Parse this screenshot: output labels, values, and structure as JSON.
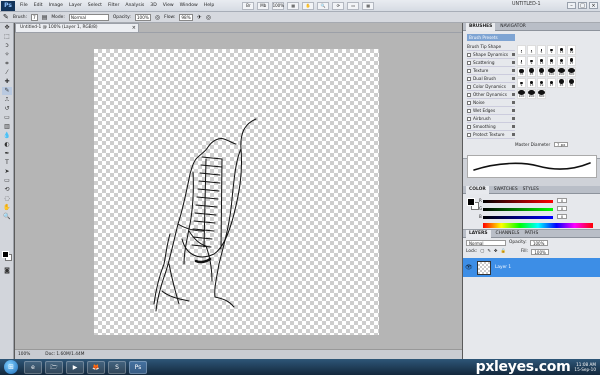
{
  "app": {
    "logo": "Ps"
  },
  "menu": [
    "File",
    "Edit",
    "Image",
    "Layer",
    "Select",
    "Filter",
    "Analysis",
    "3D",
    "View",
    "Window",
    "Help"
  ],
  "menu_icons": [
    "Br",
    "Mb",
    "100%",
    "▦",
    "✋",
    "🔍",
    "⟳",
    "▭",
    "▦"
  ],
  "workspace": "UNTITLED-1",
  "window_buttons": [
    "–",
    "□",
    "×"
  ],
  "options": {
    "brush_label": "Brush:",
    "brush_size": "7",
    "mode_label": "Mode:",
    "mode_value": "Normal",
    "opacity_label": "Opacity:",
    "opacity_value": "100%",
    "flow_label": "Flow:",
    "flow_value": "98%"
  },
  "document": {
    "tab_title": "Untitled-1 @ 100% (Layer 1, RGB/8)",
    "close": "×",
    "status_zoom": "100%",
    "status_doc": "Doc: 1.60M/1.44M"
  },
  "brushes_panel": {
    "tabs": [
      "BRUSHES",
      "NAVIGATOR"
    ],
    "preset_label": "Brush Presets",
    "items": [
      "Brush Tip Shape",
      "Shape Dynamics",
      "Scattering",
      "Texture",
      "Dual Brush",
      "Color Dynamics",
      "Other Dynamics",
      "Noise",
      "Wet Edges",
      "Airbrush",
      "Smoothing",
      "Protect Texture"
    ],
    "grid_numbers": [
      "1",
      "3",
      "5",
      "9",
      "13",
      "19",
      "5",
      "9",
      "13",
      "17",
      "21",
      "27",
      "35",
      "45",
      "65",
      "100",
      "200",
      "300",
      "9",
      "13",
      "19",
      "17",
      "45",
      "65",
      "100",
      "200",
      "300"
    ],
    "master_label": "Master Diameter",
    "master_value": "7 px"
  },
  "color_panel": {
    "tabs": [
      "COLOR",
      "SWATCHES",
      "STYLES"
    ],
    "labels": [
      "R",
      "G",
      "B"
    ],
    "values": [
      "0",
      "0",
      "0"
    ]
  },
  "layers_panel": {
    "tabs": [
      "LAYERS",
      "CHANNELS",
      "PATHS"
    ],
    "blend_mode": "Normal",
    "opacity_label": "Opacity:",
    "opacity_value": "100%",
    "lock_label": "Lock:",
    "fill_label": "Fill:",
    "fill_value": "100%",
    "layer_name": "Layer 1"
  },
  "taskbar": {
    "start": "⊞",
    "buttons": [
      "e",
      "🗁",
      "▶",
      "🦊",
      "S",
      "Ps"
    ],
    "watermark": "pxleyes.com",
    "time": "11:08 AM",
    "date": "15-Sep-10"
  }
}
